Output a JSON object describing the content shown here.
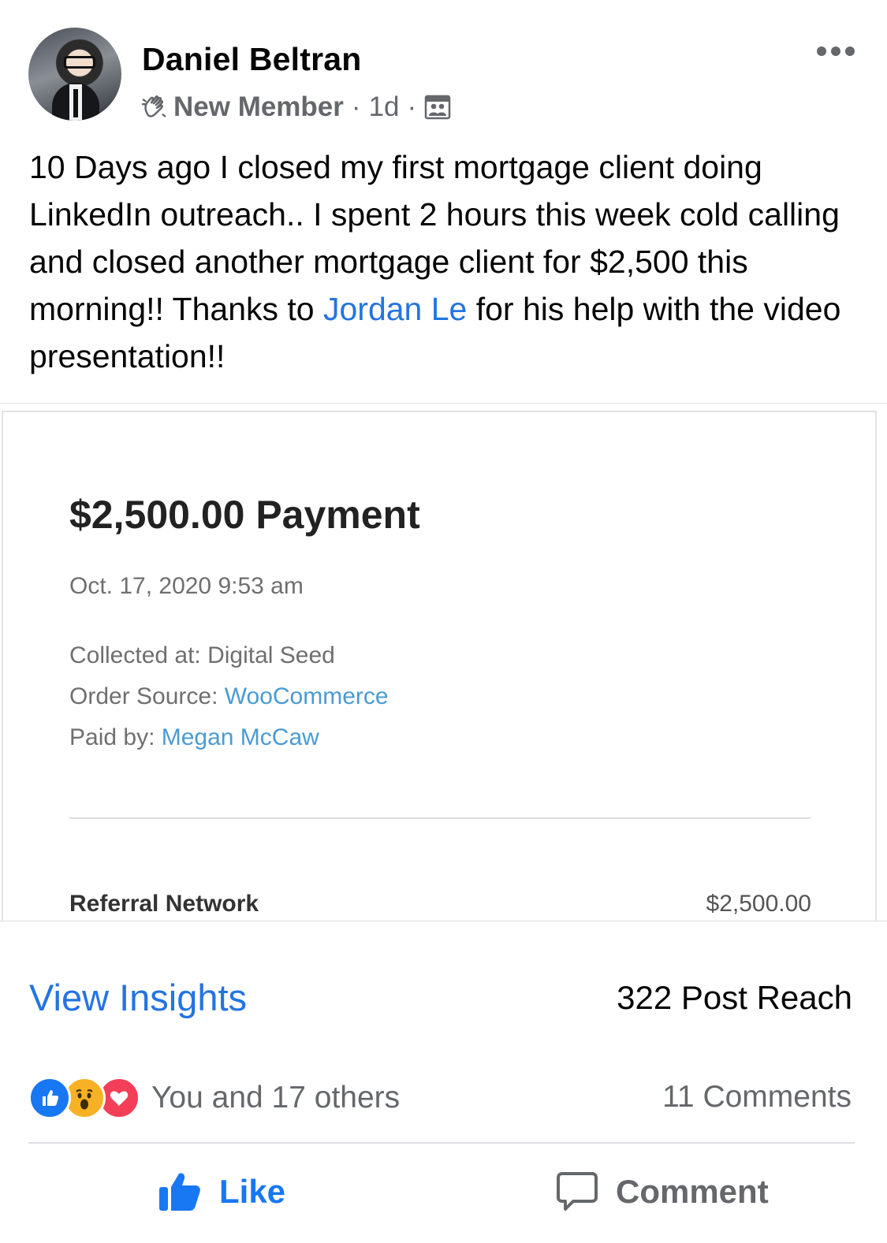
{
  "post": {
    "author": "Daniel Beltran",
    "badge": "New Member",
    "separator": "·",
    "time": "1d",
    "text_before_mention": "10 Days ago I closed my first mortgage client doing LinkedIn outreach.. I spent 2 hours this week cold calling and closed another mortgage client for $2,500 this morning!! Thanks to ",
    "mention": "Jordan Le",
    "text_after_mention": " for his help with the video presentation!!",
    "icons": {
      "badge": "wave-hand-icon",
      "audience": "group-icon",
      "menu": "more-options-icon"
    }
  },
  "receipt": {
    "title": "$2,500.00 Payment",
    "date": "Oct. 17, 2020 9:53 am",
    "collected_label": "Collected at: ",
    "collected_value": "Digital Seed",
    "order_source_label": "Order Source: ",
    "order_source_value": "WooCommerce",
    "paid_by_label": "Paid by: ",
    "paid_by_value": "Megan McCaw",
    "item_name": "Referral Network",
    "item_amount": "$2,500.00"
  },
  "insights": {
    "link": "View Insights",
    "reach": "322 Post Reach"
  },
  "engagement": {
    "reactions_text": "You and 17 others",
    "comments": "11 Comments",
    "reaction_icons": [
      "like-reaction-icon",
      "wow-reaction-icon",
      "love-reaction-icon"
    ]
  },
  "actions": {
    "like": "Like",
    "comment": "Comment"
  },
  "colors": {
    "accent": "#1877f2",
    "link": "#2374e1",
    "secondary_text": "#65676b"
  }
}
